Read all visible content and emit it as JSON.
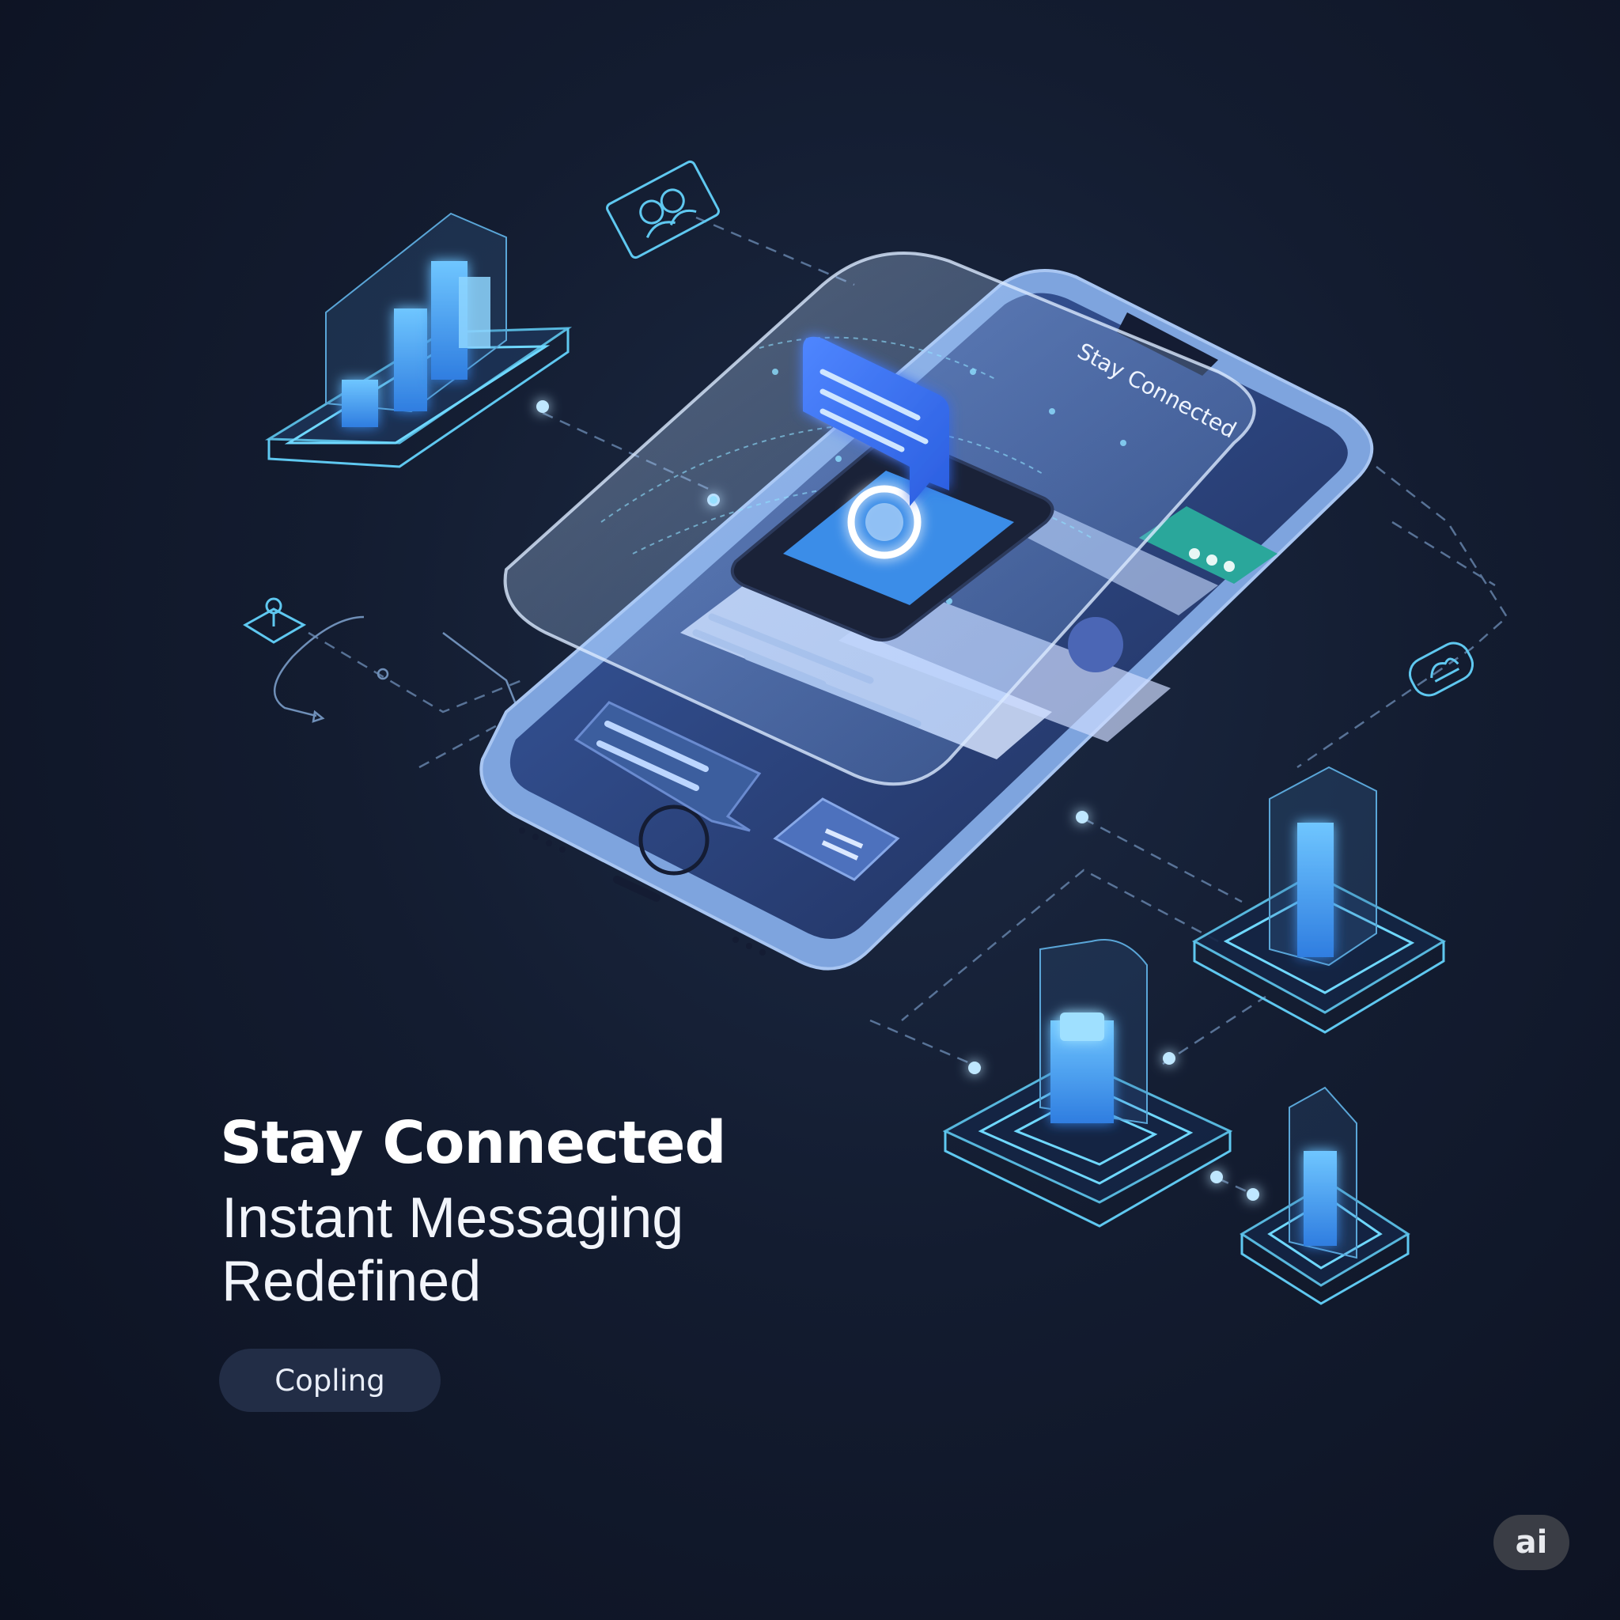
{
  "hero": {
    "headline": "Stay Connected",
    "subline": "Instant Messaging Redefined",
    "button_label": "Copling"
  },
  "phone": {
    "overlay_text": "Stay Connected"
  },
  "badge": {
    "label": "ai"
  },
  "colors": {
    "background": "#131c30",
    "accent_blue": "#3f8cf0",
    "glow_cyan": "#6fd8ff",
    "teal_bubble": "#2aa79b",
    "button_bg": "#222d46",
    "phone_frame": "#7ea4de"
  },
  "icons": [
    "people-icon",
    "power-icon",
    "cloud-icon",
    "chat-bubble-icon",
    "buildings-icon",
    "server-tower-icon"
  ]
}
